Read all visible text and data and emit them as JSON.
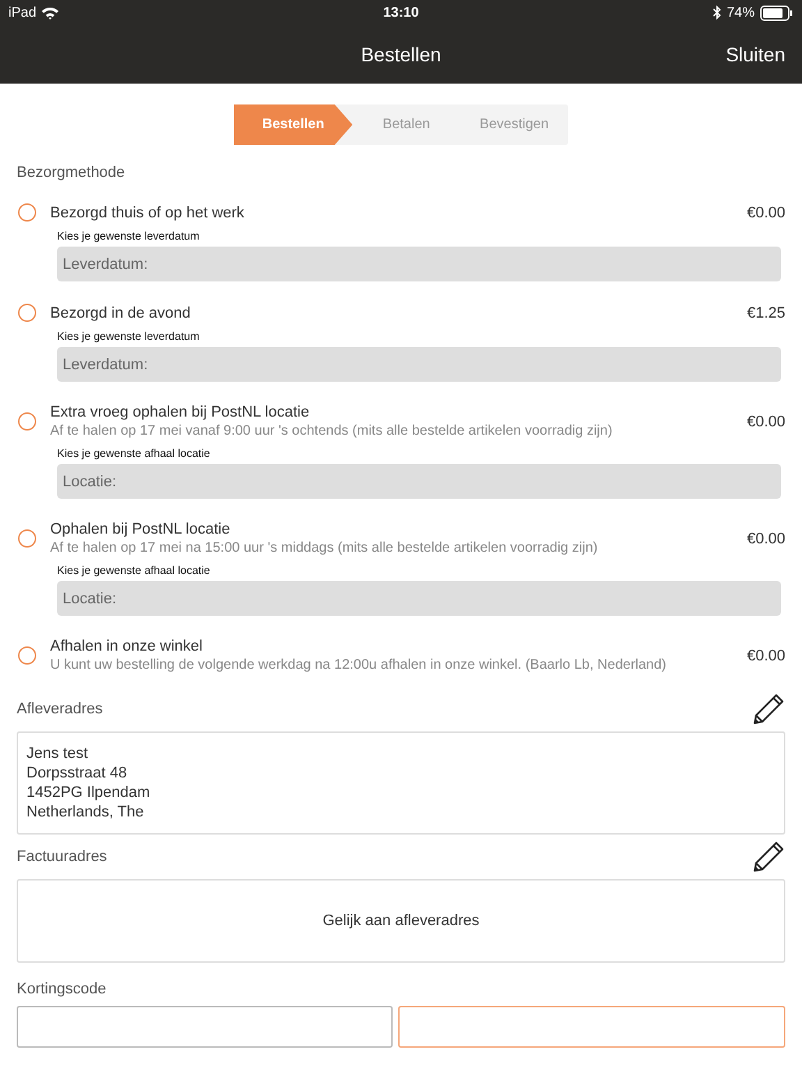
{
  "status_bar": {
    "device": "iPad",
    "time": "13:10",
    "battery_percent": "74%"
  },
  "nav": {
    "title": "Bestellen",
    "close": "Sluiten"
  },
  "steps": [
    {
      "label": "Bestellen",
      "selected": true
    },
    {
      "label": "Betalen",
      "selected": false
    },
    {
      "label": "Bevestigen",
      "selected": false
    }
  ],
  "delivery_method": {
    "heading": "Bezorgmethode",
    "options": [
      {
        "title": "Bezorgd thuis of op het werk",
        "price": "€0.00",
        "selected": false,
        "field_label": "Kies je gewenste leverdatum",
        "placeholder": "Leverdatum:"
      },
      {
        "title": "Bezorgd in de avond",
        "price": "€1.25",
        "selected": false,
        "field_label": "Kies je gewenste leverdatum",
        "placeholder": "Leverdatum:"
      },
      {
        "title": "Extra vroeg ophalen bij PostNL locatie",
        "subtitle": "Af te halen op 17 mei vanaf 9:00 uur 's ochtends (mits alle bestelde artikelen voorradig zijn)",
        "price": "€0.00",
        "selected": false,
        "field_label": "Kies je gewenste afhaal locatie",
        "placeholder": "Locatie:"
      },
      {
        "title": "Ophalen bij PostNL locatie",
        "subtitle": "Af te halen op 17 mei na 15:00 uur 's middags (mits alle bestelde artikelen voorradig zijn)",
        "price": "€0.00",
        "selected": false,
        "field_label": "Kies je gewenste afhaal locatie",
        "placeholder": "Locatie:"
      },
      {
        "title": "Afhalen in onze winkel",
        "subtitle": "U kunt uw bestelling de volgende werkdag na 12:00u afhalen in onze winkel. (Baarlo Lb, Nederland)",
        "price": "€0.00",
        "selected": false
      }
    ]
  },
  "delivery_address": {
    "heading": "Afleveradres",
    "lines": [
      "Jens test",
      "Dorpsstraat 48",
      "1452PG Ilpendam",
      "Netherlands, The"
    ]
  },
  "billing_address": {
    "heading": "Factuuradres",
    "text": "Gelijk aan afleveradres"
  },
  "discount": {
    "heading": "Kortingscode"
  }
}
